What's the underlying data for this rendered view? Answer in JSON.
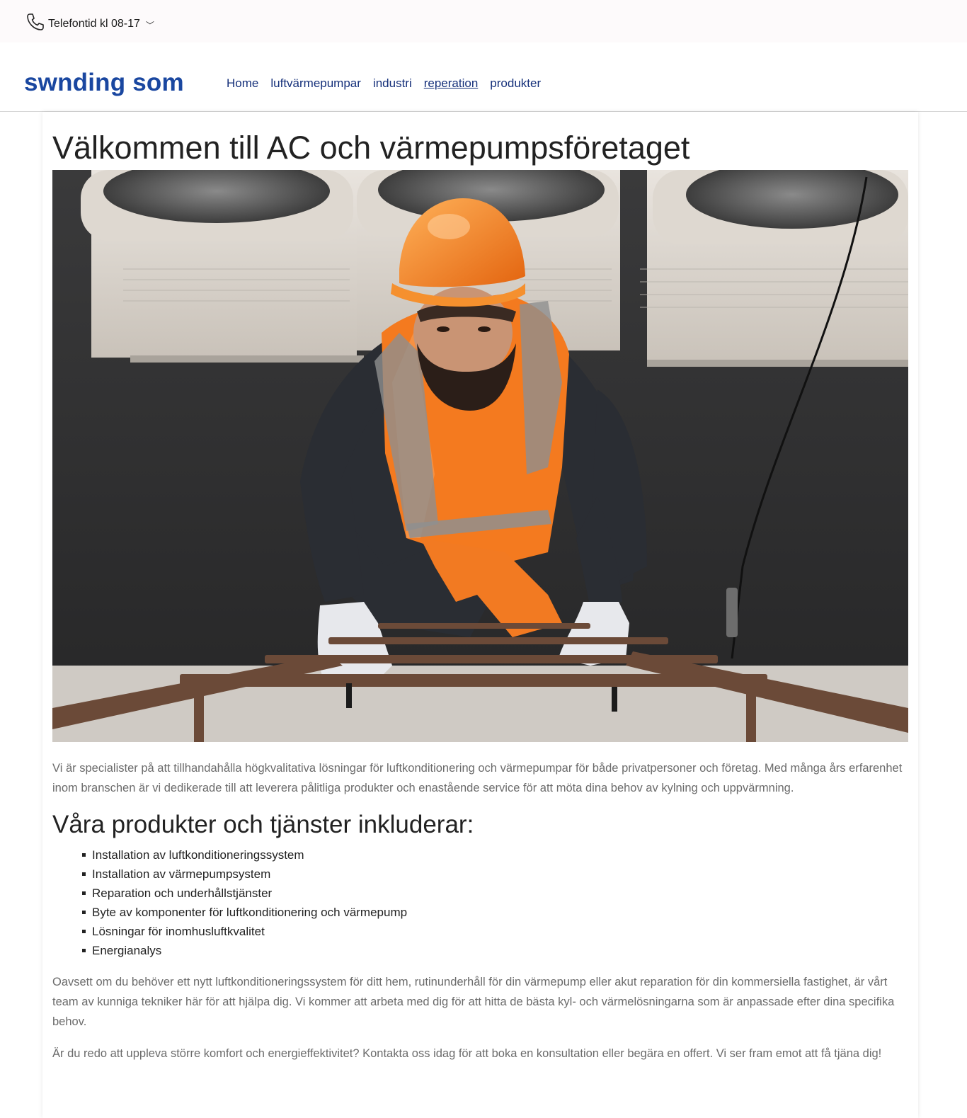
{
  "topbar": {
    "phone_label": "Telefontid kl 08-17",
    "dropdown_glyph": "﹀",
    "icon": "phone-icon"
  },
  "navbar": {
    "brand": "swnding som",
    "links": [
      {
        "label": "Home",
        "active": false
      },
      {
        "label": "luftvärmepumpar",
        "active": false
      },
      {
        "label": "industri",
        "active": false
      },
      {
        "label": "reperation",
        "active": true
      },
      {
        "label": "produkter",
        "active": false
      }
    ]
  },
  "main": {
    "title": "Välkommen till AC och värmepumpsföretaget",
    "intro": "Vi är specialister på att tillhandahålla högkvalitativa lösningar för luftkonditionering och värmepumpar för både privatpersoner och företag. Med många års erfarenhet inom branschen är vi dedikerade till att leverera pålitliga produkter och enastående service för att möta dina behov av kylning och uppvärmning.",
    "services_heading": "Våra produkter och tjänster inkluderar:",
    "services": [
      "Installation av luftkonditioneringssystem",
      "Installation av värmepumpsystem",
      "Reparation och underhållstjänster",
      "Byte av komponenter för luftkonditionering och värmepump",
      "Lösningar för inomhusluftkvalitet",
      "Energianalys"
    ],
    "paragraph2": "Oavsett om du behöver ett nytt luftkonditioneringssystem för ditt hem, rutinunderhåll för din värmepump eller akut reparation för din kommersiella fastighet, är vårt team av kunniga tekniker här för att hjälpa dig. Vi kommer att arbeta med dig för att hitta de bästa kyl- och värmelösningarna som är anpassade efter dina specifika behov.",
    "paragraph3": "Är du redo att uppleva större komfort och energieffektivitet? Kontakta oss idag för att boka en konsultation eller begära en offert. Vi ser fram emot att få tjäna dig!"
  },
  "colors": {
    "brand": "#1a47a0",
    "nav_link": "#15307a",
    "topbar_bg": "#fdfafb",
    "body_text": "#6b6b6b",
    "vest_orange": "#f47a1f"
  }
}
